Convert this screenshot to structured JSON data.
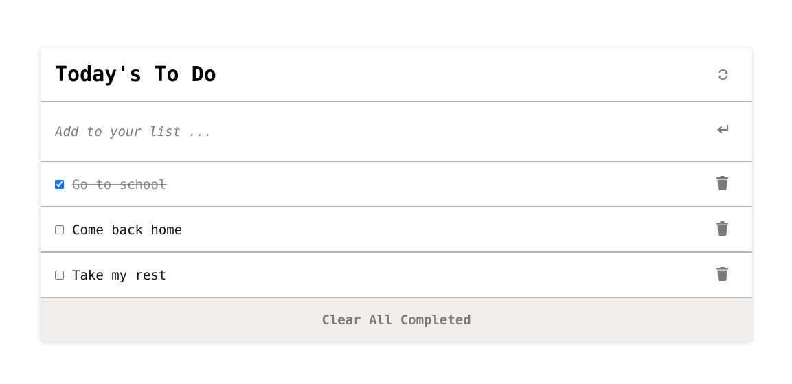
{
  "header": {
    "title": "Today's To Do",
    "refresh_icon": "refresh-icon"
  },
  "add": {
    "placeholder": "Add to your list ...",
    "value": "",
    "enter_icon": "enter-return-icon"
  },
  "todos": [
    {
      "label": "Go to school",
      "done": true
    },
    {
      "label": "Come back home",
      "done": false
    },
    {
      "label": "Take my rest",
      "done": false
    }
  ],
  "footer": {
    "clear_label": "Clear All Completed"
  },
  "colors": {
    "border": "#b4b4b4",
    "icon": "#7a7a7a",
    "footer_bg": "#f0eded",
    "checkbox_accent": "#1a73e8"
  }
}
